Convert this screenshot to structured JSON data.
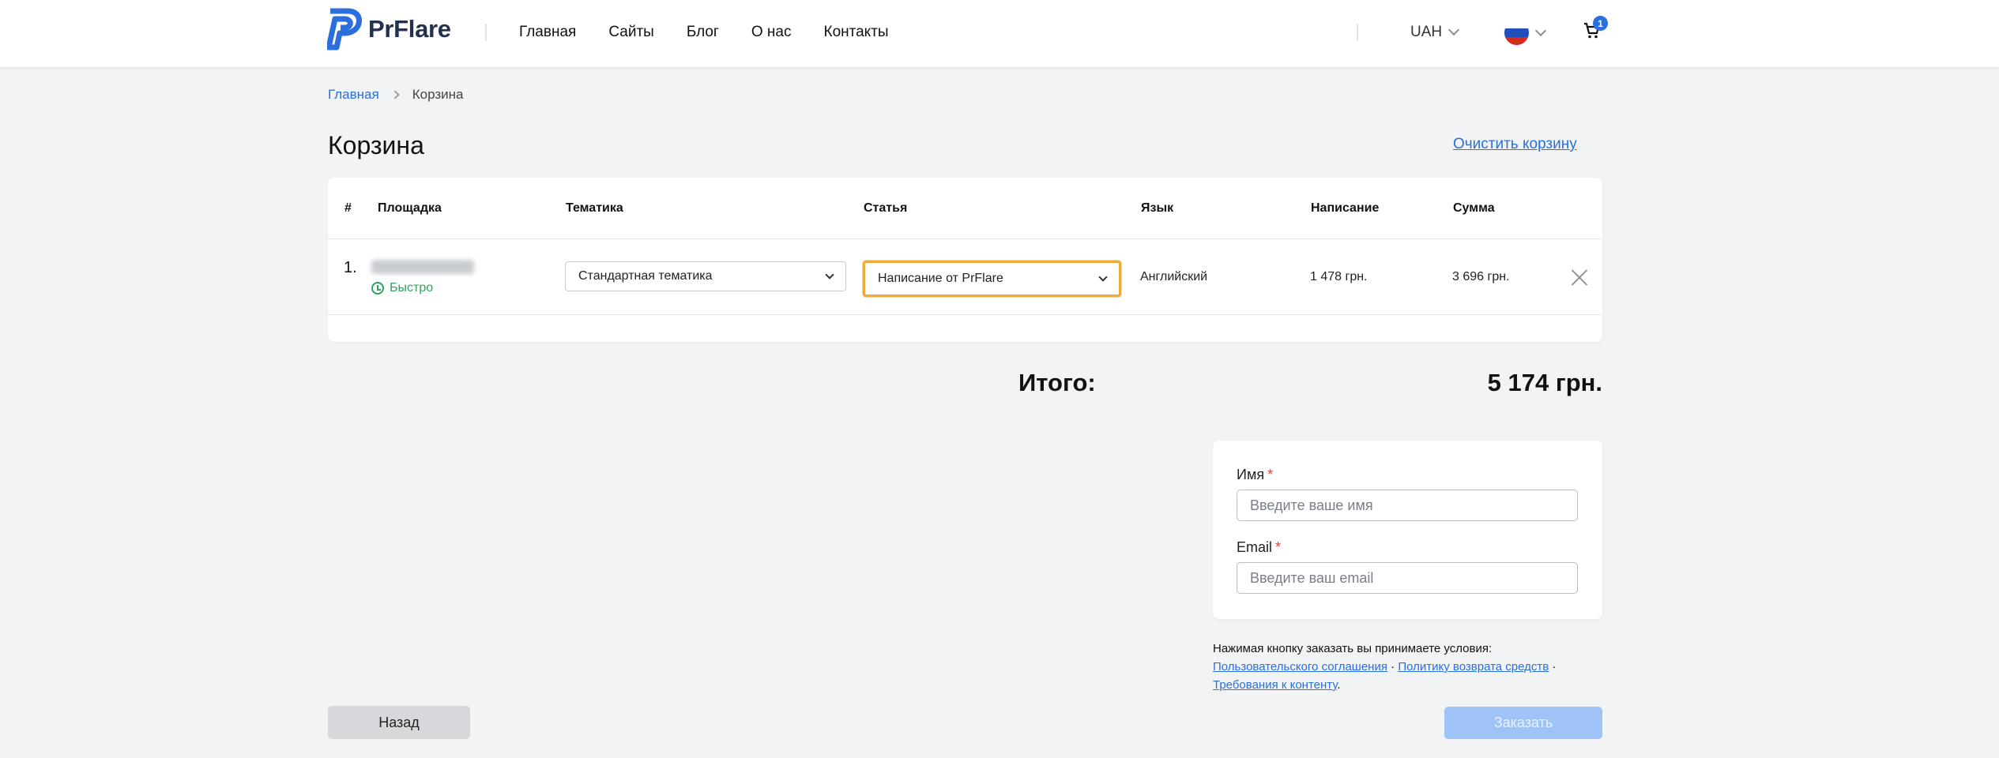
{
  "header": {
    "logo_text": "PrFlare",
    "nav": [
      "Главная",
      "Сайты",
      "Блог",
      "О нас",
      "Контакты"
    ],
    "currency": "UAH",
    "cart_count": "1"
  },
  "breadcrumb": {
    "home": "Главная",
    "current": "Корзина"
  },
  "page": {
    "title": "Корзина",
    "clear_cart": "Очистить корзину"
  },
  "table": {
    "headers": [
      "#",
      "Площадка",
      "Тематика",
      "Статья",
      "Язык",
      "Написание",
      "Сумма"
    ],
    "rows": [
      {
        "num": "1.",
        "speed": "Быстро",
        "topic": "Стандартная тематика",
        "article": "Написание от PrFlare",
        "language": "Английский",
        "writing": "1 478 грн.",
        "sum": "3 696 грн."
      }
    ]
  },
  "total": {
    "label": "Итого:",
    "value": "5 174 грн."
  },
  "form": {
    "name_label": "Имя",
    "name_placeholder": "Введите ваше имя",
    "email_label": "Email",
    "email_placeholder": "Введите ваш email",
    "required_mark": "*"
  },
  "terms": {
    "text": "Нажимая кнопку заказать вы принимаете условия:",
    "link1": "Пользовательского соглашения",
    "link2": "Политику возврата средств",
    "link3": "Требования к контенту",
    "sep": "·",
    "end": "."
  },
  "buttons": {
    "back": "Назад",
    "order": "Заказать"
  },
  "colors": {
    "accent": "#2a6fdb",
    "success": "#2da35c",
    "focus": "#f0a93b",
    "order_disabled": "#9ec4f7"
  }
}
